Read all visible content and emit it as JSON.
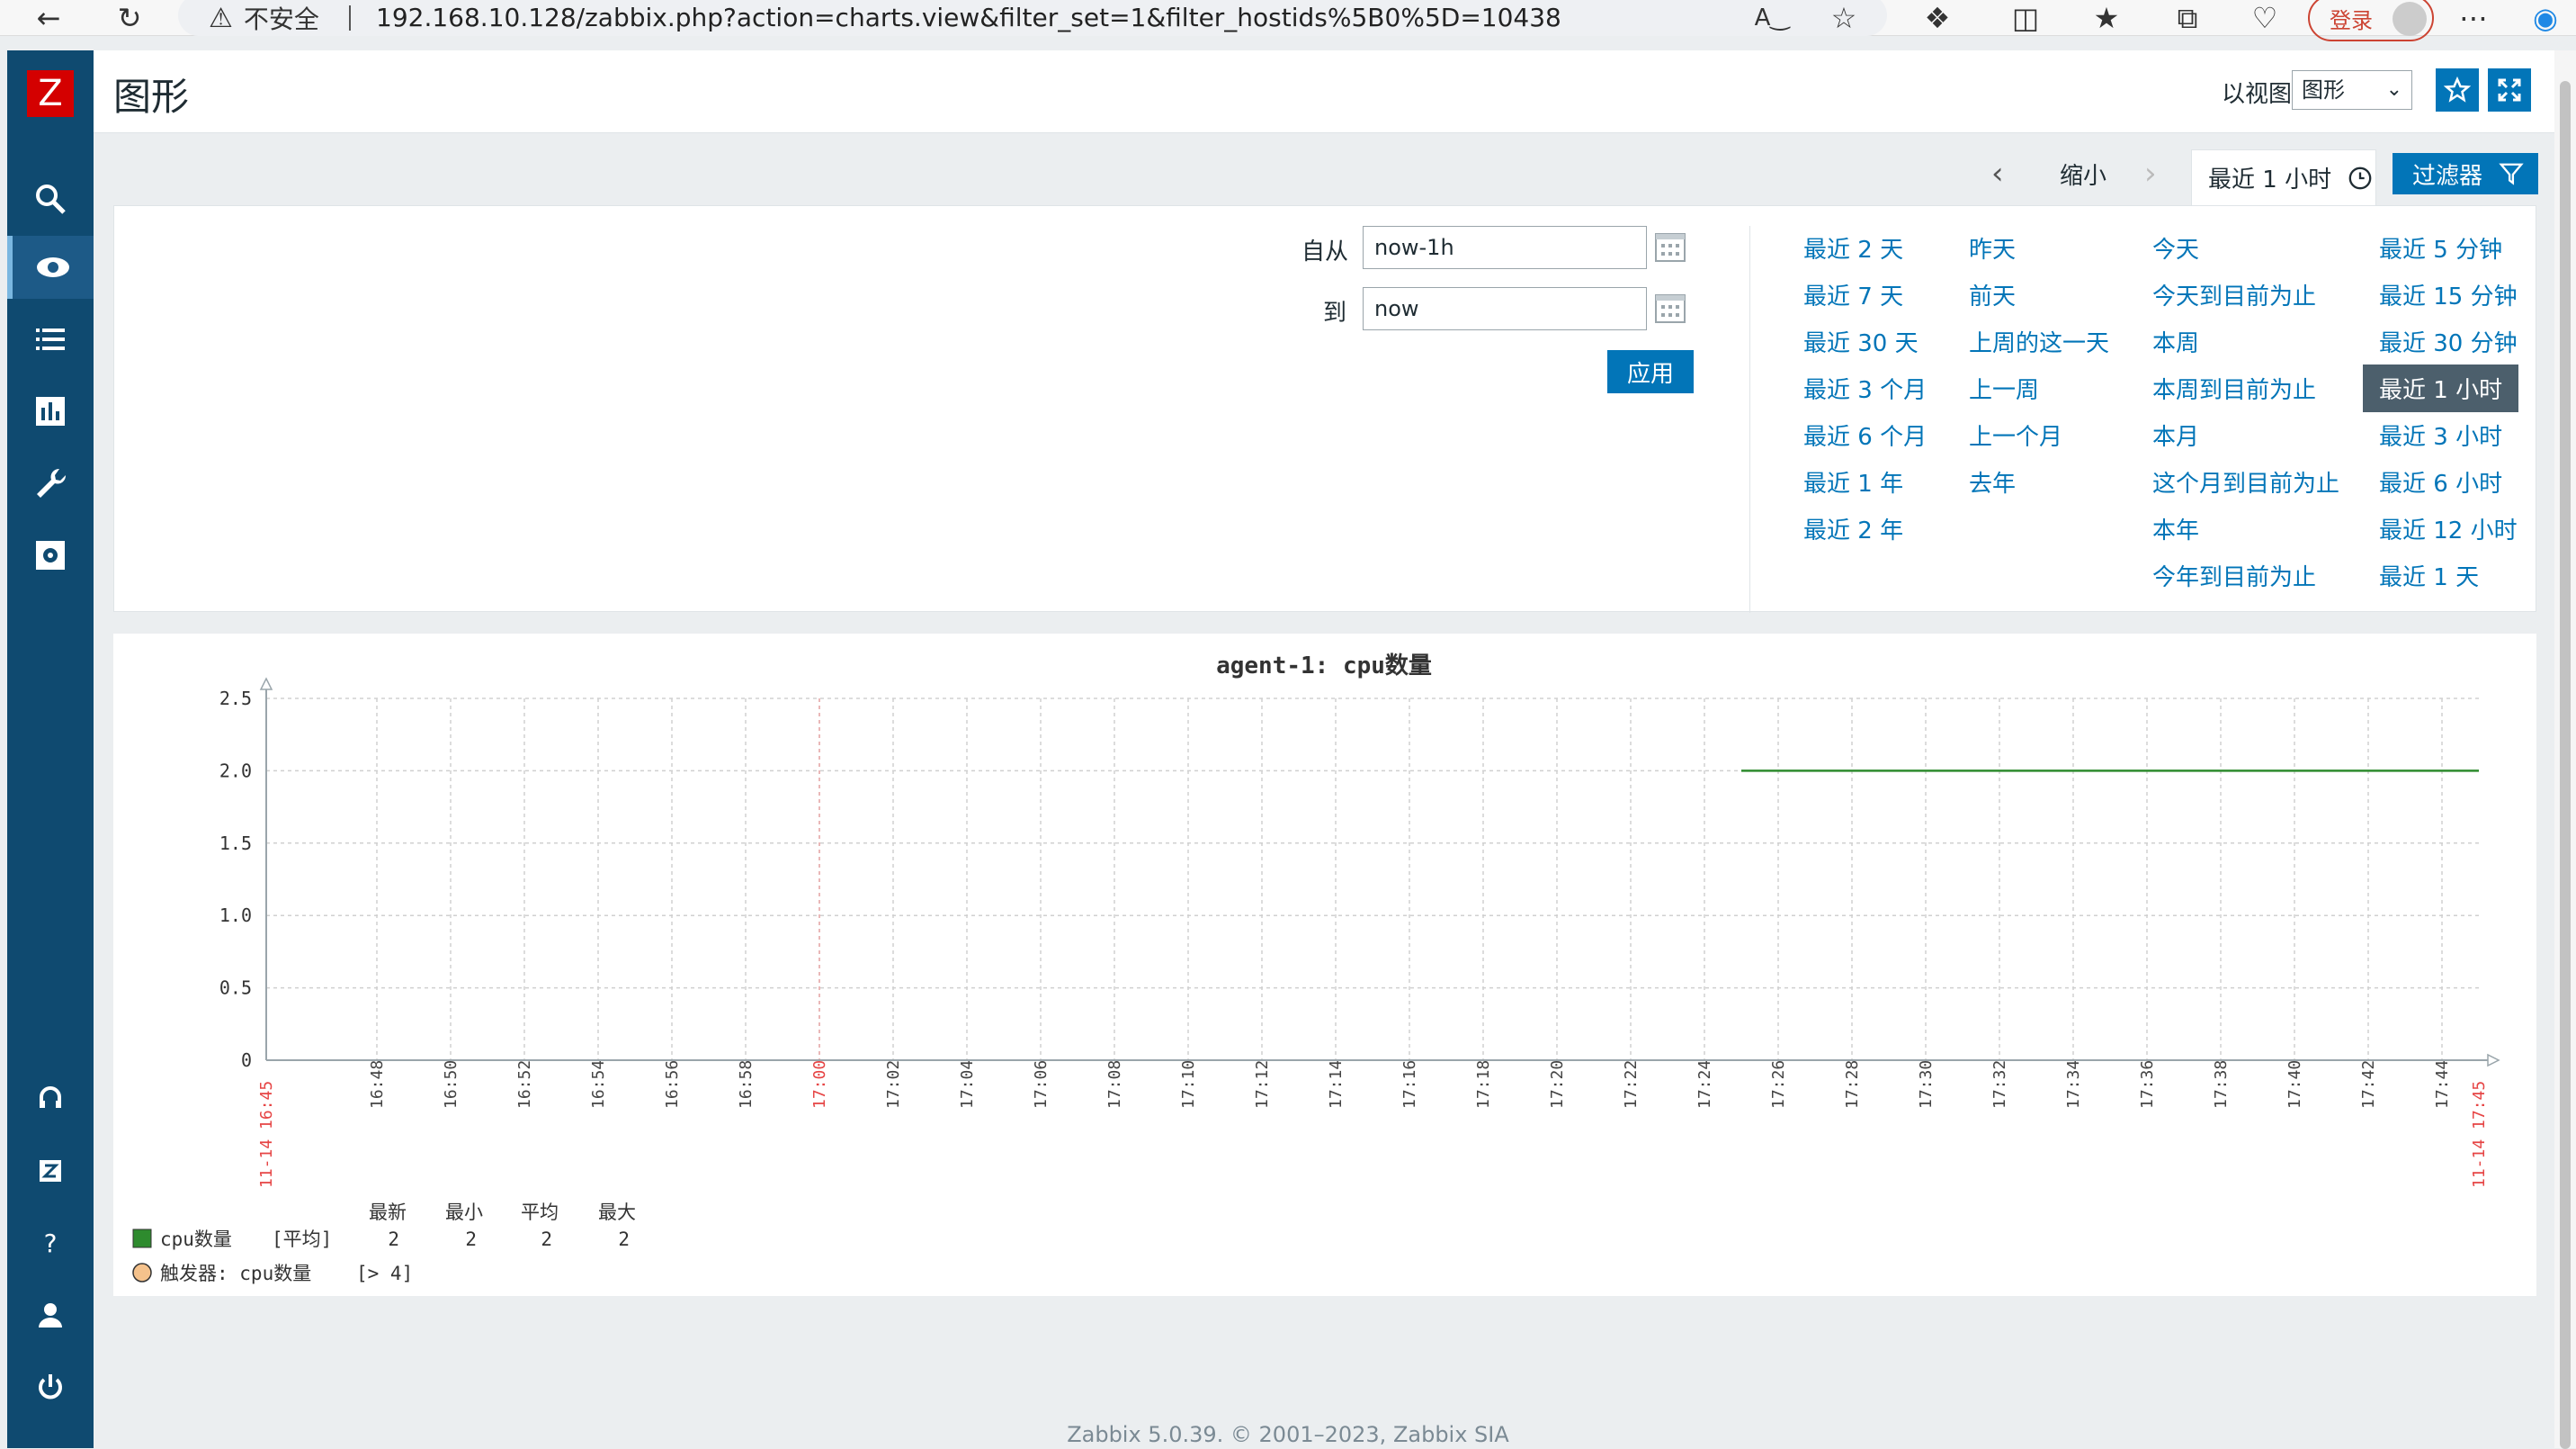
{
  "browser": {
    "security_label": "不安全",
    "url": "192.168.10.128/zabbix.php?action=charts.view&filter_set=1&filter_hostids%5B0%5D=10438",
    "login_label": "登录"
  },
  "header": {
    "title": "图形",
    "view_as_label": "以视图",
    "view_select_value": "图形"
  },
  "time_controls": {
    "zoom_out_label": "缩小",
    "current_period": "最近 1 小时",
    "filter_label": "过滤器"
  },
  "filter": {
    "from_label": "自从",
    "from_value": "now-1h",
    "to_label": "到",
    "to_value": "now",
    "apply_label": "应用",
    "quick_ranges": [
      [
        "最近 2 天",
        "最近 7 天",
        "最近 30 天",
        "最近 3 个月",
        "最近 6 个月",
        "最近 1 年",
        "最近 2 年"
      ],
      [
        "昨天",
        "前天",
        "上周的这一天",
        "上一周",
        "上一个月",
        "去年"
      ],
      [
        "今天",
        "今天到目前为止",
        "本周",
        "本周到目前为止",
        "本月",
        "这个月到目前为止",
        "本年",
        "今年到目前为止"
      ],
      [
        "最近 5 分钟",
        "最近 15 分钟",
        "最近 30 分钟",
        "最近 1 小时",
        "最近 3 小时",
        "最近 6 小时",
        "最近 12 小时",
        "最近 1 天"
      ]
    ],
    "selected_range": "最近 1 小时"
  },
  "chart_data": {
    "type": "line",
    "title": "agent-1: cpu数量",
    "ylim": [
      0,
      2.5
    ],
    "y_ticks": [
      "0",
      "0.5",
      "1.0",
      "1.5",
      "2.0",
      "2.5"
    ],
    "x_ticks": [
      "16:45",
      "16:48",
      "16:50",
      "16:52",
      "16:54",
      "16:56",
      "16:58",
      "17:00",
      "17:02",
      "17:04",
      "17:06",
      "17:08",
      "17:10",
      "17:12",
      "17:14",
      "17:16",
      "17:18",
      "17:20",
      "17:22",
      "17:24",
      "17:26",
      "17:28",
      "17:30",
      "17:32",
      "17:34",
      "17:36",
      "17:38",
      "17:40",
      "17:42",
      "17:44",
      "17:45"
    ],
    "x_start_date": "11-14",
    "x_end_date": "11-14",
    "x_range": [
      "16:45",
      "17:45"
    ],
    "series": [
      {
        "name": "cpu数量",
        "color": "#2e8b2e",
        "x": [
          "17:25",
          "17:45"
        ],
        "values": [
          2,
          2
        ]
      }
    ],
    "legend": {
      "headers": [
        "最新",
        "最小",
        "平均",
        "最大"
      ],
      "series_label": "cpu数量",
      "func_label": "[平均]",
      "values": [
        "2",
        "2",
        "2",
        "2"
      ],
      "trigger_label": "触发器: cpu数量",
      "trigger_cond": "[> 4]"
    },
    "grid": true
  },
  "footer": "Zabbix 5.0.39. © 2001–2023, Zabbix SIA"
}
